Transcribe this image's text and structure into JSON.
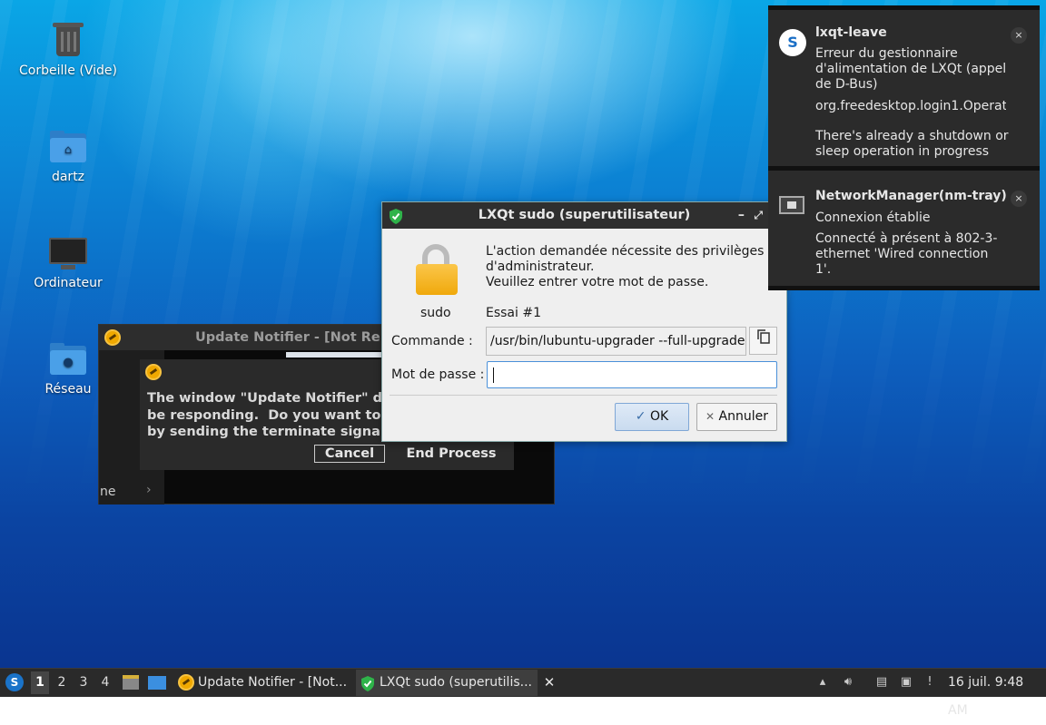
{
  "desktop": {
    "icons": [
      {
        "label": "Corbeille (Vide)",
        "icon": "trash-icon"
      },
      {
        "label": "dartz",
        "icon": "home-folder-icon"
      },
      {
        "label": "Ordinateur",
        "icon": "computer-icon"
      },
      {
        "label": "Réseau",
        "icon": "network-folder-icon"
      }
    ]
  },
  "update_notifier_window": {
    "title": "Update Notifier - [Not Re",
    "sidebar_text": "ne",
    "chevron": "›"
  },
  "kill_dialog": {
    "message": "The window \"Update Notifier\" d\nbe responding.  Do you want to\nby sending the terminate signa",
    "cancel_label": "Cancel",
    "end_process_label": "End Process"
  },
  "sudo_dialog": {
    "title": "LXQt sudo (superutilisateur)",
    "min_glyph": "–",
    "max_glyph": "⤢",
    "message_line1": "L'action demandée nécessite des privilèges",
    "message_line2": "d'administrateur.",
    "message_line3": "Veuillez entrer votre mot de passe.",
    "user_label": "sudo",
    "attempt_label": "Essai #1",
    "command_label": "Commande :",
    "command_value": "/usr/bin/lubuntu-upgrader --full-upgrade",
    "password_label": "Mot de passe :",
    "password_value": "",
    "ok_label": "OK",
    "cancel_label": "Annuler"
  },
  "notifications": [
    {
      "app": "lxqt-leave",
      "body1": "Erreur du gestionnaire\nd'alimentation de LXQt (appel\nde D-Bus)",
      "body2": "org.freedesktop.login1.Operat",
      "body3": "There's already a shutdown or\nsleep operation in progress",
      "close": "×"
    },
    {
      "app": "NetworkManager(nm-tray)",
      "body1": "Connexion établie",
      "body2": "Connecté à présent à 802-3-\nethernet 'Wired connection\n1'.",
      "close": "×"
    }
  ],
  "taskbar": {
    "desktops": [
      "1",
      "2",
      "3",
      "4"
    ],
    "active_desktop": "1",
    "tasks": [
      {
        "label": "Update Notifier - [Not...",
        "icon": "update-notifier-icon"
      },
      {
        "label": "LXQt sudo (superutilis...",
        "icon": "shield-icon",
        "active": true
      }
    ],
    "close_glyph": "✕",
    "clock": "16 juil. 9:48 AM"
  },
  "colors": {
    "accent": "#4a90d9",
    "taskbar_bg": "#2a2a2a",
    "shield_green": "#2fb34a",
    "lock_gold": "#f0a90c"
  }
}
